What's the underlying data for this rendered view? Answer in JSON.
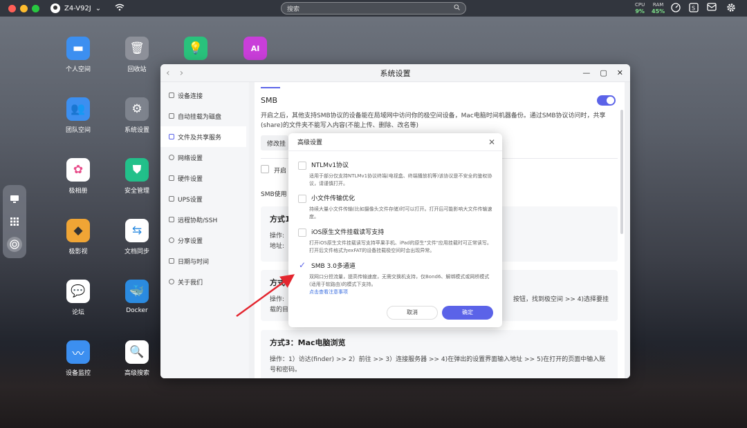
{
  "topbar": {
    "device": "Z4-V92J",
    "device_chevron": "⌄",
    "search_placeholder": "搜索",
    "cpu_label": "CPU",
    "cpu_value": "9%",
    "ram_label": "RAM",
    "ram_value": "45%"
  },
  "desktop": {
    "icons": [
      {
        "label": "个人空间",
        "color": "#3c8ff0",
        "glyph": "▬"
      },
      {
        "label": "回收站",
        "color": "#8d9099",
        "glyph": "🗑"
      },
      {
        "label": "",
        "color": "#29c27c",
        "glyph": "💡"
      },
      {
        "label": "",
        "color": "#c93ed9",
        "glyph": "AI"
      },
      {
        "label": "团队空间",
        "color": "#3c8ff0",
        "glyph": "👥"
      },
      {
        "label": "系统设置",
        "color": "#7e838d",
        "glyph": "⚙"
      },
      {
        "label": "极相册",
        "color": "#ffffff",
        "glyph": "✿"
      },
      {
        "label": "安全管理",
        "color": "#22c08a",
        "glyph": "⛊"
      },
      {
        "label": "极影视",
        "color": "#f0a535",
        "glyph": "◆"
      },
      {
        "label": "文档同步",
        "color": "#ffffff",
        "glyph": "⇆"
      },
      {
        "label": "论坛",
        "color": "#ffffff",
        "glyph": "💬"
      },
      {
        "label": "Docker",
        "color": "#2b8be0",
        "glyph": "🐳"
      },
      {
        "label": "设备监控",
        "color": "#3c8ff0",
        "glyph": "〰"
      },
      {
        "label": "高级搜索",
        "color": "#ffffff",
        "glyph": "🔍"
      }
    ]
  },
  "window": {
    "title": "系统设置",
    "sidebar": [
      {
        "label": "设备连接"
      },
      {
        "label": "自动挂载为磁盘"
      },
      {
        "label": "文件及共享服务",
        "active": true
      },
      {
        "label": "网络设置"
      },
      {
        "label": "硬件设置"
      },
      {
        "label": "UPS设置"
      },
      {
        "label": "远程协助/SSH"
      },
      {
        "label": "分享设置"
      },
      {
        "label": "日期与时间"
      },
      {
        "label": "关于我们"
      }
    ],
    "smb_title": "SMB",
    "smb_desc": "开启之后，其他支持SMB协议的设备能在局域网中访问你的极空间设备，Mac电脑时间机器备份。通过SMB协议访问时，共享(share)的文件夹不能写入内容(不能上传、删除、改名等)",
    "modify_btn": "修改挂",
    "enable_text": "开启",
    "smb_use": "SMB使用",
    "card1_title": "方式1",
    "card1_line1": "操作:",
    "card1_line2": "地址:",
    "card2_title": "方式2",
    "card2_line1": "操作:",
    "card2_line1_tail": "按钮，找到极空间 >> 4)选择要挂",
    "card2_line2": "载的目",
    "card3_title": "方式3：Mac电脑浏览",
    "card3_text": "操作：1）访达(finder) >> 2）前往 >> 3）连接服务器 >> 4)在弹出的设置界面输入地址 >> 5)在打开的页面中输入账号和密码。"
  },
  "dialog": {
    "title": "高级设置",
    "options": [
      {
        "title": "NTLMv1协议",
        "desc": "适用于部分仅支持NTLMv1协议终端(电视盒、终端播放机等)该协议是不安全的鉴权协议，请谨慎打开。",
        "checked": false
      },
      {
        "title": "小文件传输优化",
        "desc": "持续大量小文件传输(比如摄像头文件存储)时可以打开。打开后可能影响大文件传输速度。",
        "checked": false
      },
      {
        "title": "iOS原生文件挂载读写支持",
        "desc": "打开iOS原生文件挂载读写支持苹果手机、iPad的原生\"文件\"应用挂载时可正常读写。打开后文件格式为exFAT的设备挂载极空间时会出现异常。",
        "checked": false
      },
      {
        "title": "SMB 3.0多通道",
        "desc": "双网口分担流量，提高传输速度，无需交换机支持，仅Bond6、解绑模式或网桥模式(适用于软路由)的模式下支持。",
        "checked": true,
        "link": "点击查看注意事项"
      }
    ],
    "cancel": "取消",
    "ok": "确定"
  }
}
